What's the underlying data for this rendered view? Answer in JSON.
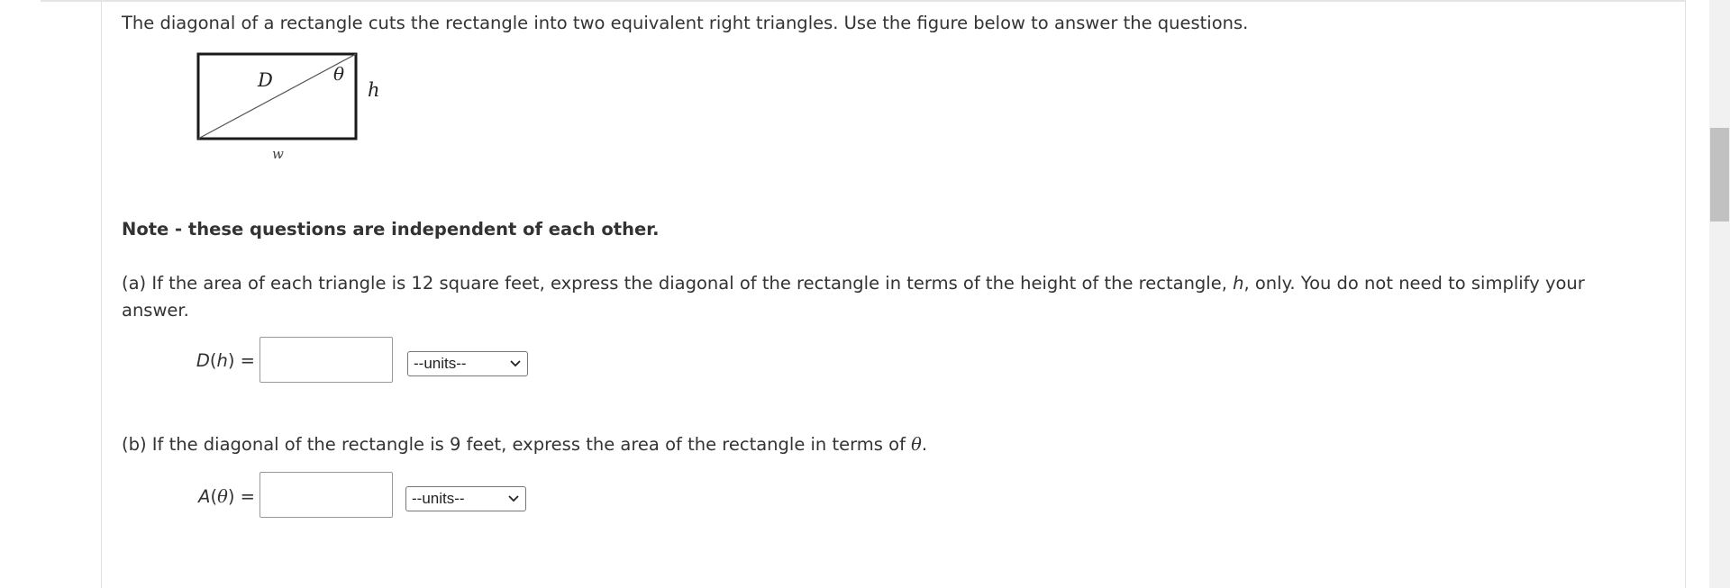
{
  "question": {
    "intro": "The diagonal of a rectangle cuts the rectangle into two equivalent right triangles. Use the figure below to answer the questions.",
    "figure_labels": {
      "diagonal": "D",
      "angle": "θ",
      "height": "h",
      "width": "w"
    },
    "note": "Note - these questions are independent of each other.",
    "part_a": {
      "text_before": "(a) If the area of each triangle is 12 square feet, express the diagonal of the rectangle in terms of the height of the rectangle, ",
      "var": "h",
      "text_after": ", only. You do not need to simplify your answer.",
      "fn_name": "D",
      "fn_arg": "h",
      "equals": "=",
      "input_value": "",
      "units_selected": "--units--"
    },
    "part_b": {
      "text_before": "(b) If the diagonal of the rectangle is 9 feet, express the area of the rectangle in terms of ",
      "var": "θ",
      "text_after": ".",
      "fn_name": "A",
      "fn_arg": "θ",
      "equals": "=",
      "input_value": "",
      "units_selected": "--units--"
    }
  },
  "colors": {
    "scroll_track": "#f1f1f1",
    "scroll_thumb": "#c1c1c1",
    "text": "#333333"
  }
}
